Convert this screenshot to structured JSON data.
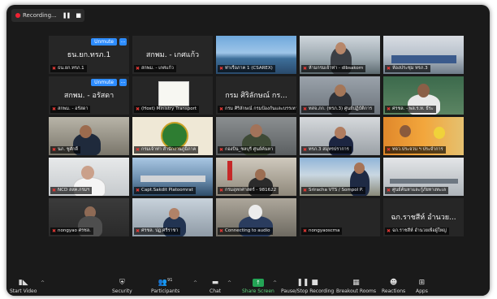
{
  "recording": {
    "label": "Recording...",
    "pause": "❚❚",
    "stop": "■"
  },
  "tiles": [
    {
      "name": "ธน.ยก.ทรภ.1",
      "big": "ธน.ยก.ทรภ.1",
      "unmute": "Unmute"
    },
    {
      "name": "สกพม. - เกศแก้ว",
      "big": "สกพม. - เกศแก้ว"
    },
    {
      "name": "ท่าเรือภาค 1 (CSAREX)",
      "big": ""
    },
    {
      "name": "ห้ามกรมเจ้าท่า - dlbsakorn",
      "big": ""
    },
    {
      "name": "ห้องประชุม ทรภ.3",
      "big": ""
    },
    {
      "name": "สกพม. - อรัสดา",
      "big": "สกพม. - อรัสดา",
      "unmute": "Unmute"
    },
    {
      "name": "(Host) Ministry Transport",
      "big": ""
    },
    {
      "name": "กรม ศิริลักษณ์ กรมป้องกันและบรรเทา",
      "big": "กรม ศิริลักษณ์ กร..."
    },
    {
      "name": "ทสจ.ภก. (ทรภ.3) ศูนย์ปฏิบัติการ",
      "big": ""
    },
    {
      "name": "ศรชล. - พล.ร.ท. ธีระ",
      "big": ""
    },
    {
      "name": "นภ. ชูศักดิ์",
      "big": ""
    },
    {
      "name": "กรมเจ้าท่า สำนักงานภูมิภาค",
      "big": ""
    },
    {
      "name": "กองบิน_ชลบุรี ศูนย์ค้นหา",
      "big": ""
    },
    {
      "name": "ทรภ.3 สมุทรปราการ",
      "big": ""
    },
    {
      "name": "ทจว.ประจวบ ฯ ประจำการ",
      "big": ""
    },
    {
      "name": "NCD สสค.กรมฯ",
      "big": ""
    },
    {
      "name": "Capt.Sakdit Piatoomrat",
      "big": ""
    },
    {
      "name": "กรมอุทกศาสตร์ - 981622",
      "big": ""
    },
    {
      "name": "Sriracha VTS / Sompol P.",
      "big": ""
    },
    {
      "name": "ศูนย์ค้นหาและกู้ภัยทางทะเล",
      "big": ""
    },
    {
      "name": "nongyao ศรชล.",
      "big": ""
    },
    {
      "name": "ศรชล. ปฏ.ศรีราชา",
      "big": ""
    },
    {
      "name": "Connecting to audio",
      "big": ""
    },
    {
      "name": "nongyaoscma",
      "big": ""
    },
    {
      "name": "ฉก.ราชสีห์ อำนวยเพื่อผู้ใหญ่",
      "big": "ฉก.ราชสีห์ อำนวย..."
    }
  ],
  "toolbar": {
    "video": "Start Video",
    "security": "Security",
    "participants": "Participants",
    "participants_count": "91",
    "chat": "Chat",
    "share": "Share Screen",
    "record": "Pause/Stop Recording",
    "breakout": "Breakout Rooms",
    "reactions": "Reactions",
    "apps": "Apps"
  }
}
